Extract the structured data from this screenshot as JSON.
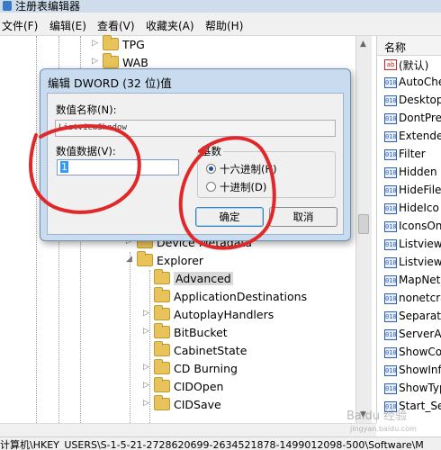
{
  "window": {
    "title": "注册表编辑器"
  },
  "menu": [
    "文件(F)",
    "编辑(E)",
    "查看(V)",
    "收藏夹(A)",
    "帮助(H)"
  ],
  "tree": {
    "items": [
      {
        "label": "TPG",
        "expand": "▷"
      },
      {
        "label": "WAB",
        "expand": "▷"
      },
      {
        "label": "Device Metadata",
        "expand": "▷"
      },
      {
        "label": "Explorer",
        "expand": "◢"
      },
      {
        "label": "Advanced",
        "expand": ""
      },
      {
        "label": "ApplicationDestinations",
        "expand": ""
      },
      {
        "label": "AutoplayHandlers",
        "expand": "▷"
      },
      {
        "label": "BitBucket",
        "expand": "▷"
      },
      {
        "label": "CabinetState",
        "expand": ""
      },
      {
        "label": "CD Burning",
        "expand": "▷"
      },
      {
        "label": "CIDOpen",
        "expand": "▷"
      },
      {
        "label": "CIDSave",
        "expand": "▷"
      }
    ]
  },
  "values_pane": {
    "header": "名称",
    "items": [
      {
        "name": "(默认)",
        "icon": "ab"
      },
      {
        "name": "AutoChe",
        "icon": "bin"
      },
      {
        "name": "Desktop",
        "icon": "bin"
      },
      {
        "name": "DontPre",
        "icon": "bin"
      },
      {
        "name": "Extende",
        "icon": "bin"
      },
      {
        "name": "Filter",
        "icon": "bin"
      },
      {
        "name": "Hidden",
        "icon": "bin"
      },
      {
        "name": "HideFile",
        "icon": "bin"
      },
      {
        "name": "HideIco",
        "icon": "bin"
      },
      {
        "name": "IconsOn",
        "icon": "bin"
      },
      {
        "name": "Listviewa",
        "icon": "bin"
      },
      {
        "name": "ListviewS",
        "icon": "bin"
      },
      {
        "name": "MapNet",
        "icon": "bin"
      },
      {
        "name": "nonetcra",
        "icon": "bin"
      },
      {
        "name": "Separat",
        "icon": "bin"
      },
      {
        "name": "ServerA",
        "icon": "bin"
      },
      {
        "name": "ShowCo",
        "icon": "bin"
      },
      {
        "name": "ShowInf",
        "icon": "bin"
      },
      {
        "name": "ShowTyp",
        "icon": "bin"
      },
      {
        "name": "Start_Se",
        "icon": "bin"
      }
    ]
  },
  "status": "计算机\\HKEY_USERS\\S-1-5-21-2728620699-2634521878-1499012098-500\\Software\\M",
  "dialog": {
    "title": "编辑 DWORD (32 位)值",
    "name_label": "数值名称(N):",
    "name_value": "ListviewShadow",
    "data_label": "数值数据(V):",
    "data_value": "1",
    "base_label": "基数",
    "hex_label": "十六进制(H)",
    "dec_label": "十进制(D)",
    "selected_base": "hex",
    "ok_label": "确定",
    "cancel_label": "取消"
  },
  "colors": {
    "annotation": "#e0282a",
    "folder": "#e8c25a",
    "dialog_frame": "#c9dcef"
  },
  "watermark": "Baidu 经验 jingyan.baidu.com"
}
